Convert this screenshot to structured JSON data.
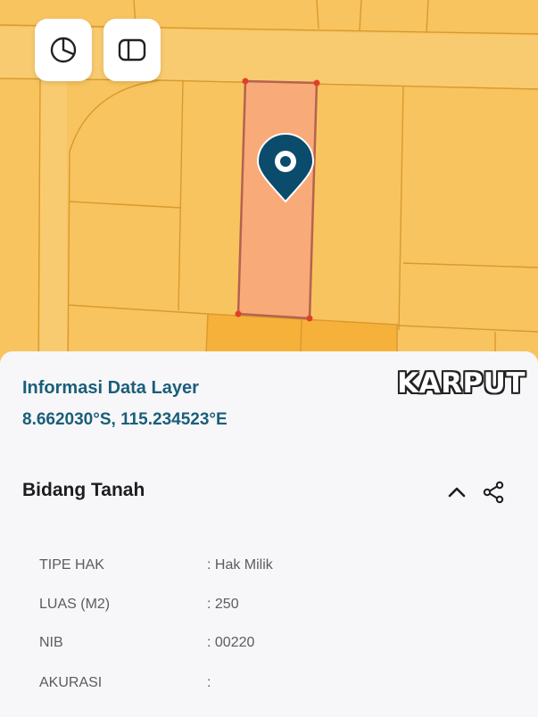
{
  "map": {
    "buttons": [
      {
        "name": "chart-pie-icon",
        "action": "layer-statistics"
      },
      {
        "name": "panel-icon",
        "action": "toggle-panel"
      }
    ],
    "colors": {
      "base": "#f8c460",
      "parcel_line": "#d89a2c",
      "selected_fill": "#f8aa78",
      "selected_stroke": "#b5624f",
      "vertex": "#e0402a",
      "dark_parcel": "#f6b13b",
      "marker": "#0b4b6b"
    }
  },
  "info": {
    "title": "Informasi Data Layer",
    "coordinates": "8.662030°S, 115.234523°E",
    "watermark": "KARPUT"
  },
  "section": {
    "title": "Bidang Tanah",
    "collapse_icon": "chevron-up-icon",
    "share_icon": "share-icon"
  },
  "rows": [
    {
      "label": "TIPE HAK",
      "value": ": Hak Milik"
    },
    {
      "label": "LUAS (M2)",
      "value": ": 250"
    },
    {
      "label": "NIB",
      "value": ": 00220"
    },
    {
      "label": "AKURASI",
      "value": ":"
    }
  ]
}
